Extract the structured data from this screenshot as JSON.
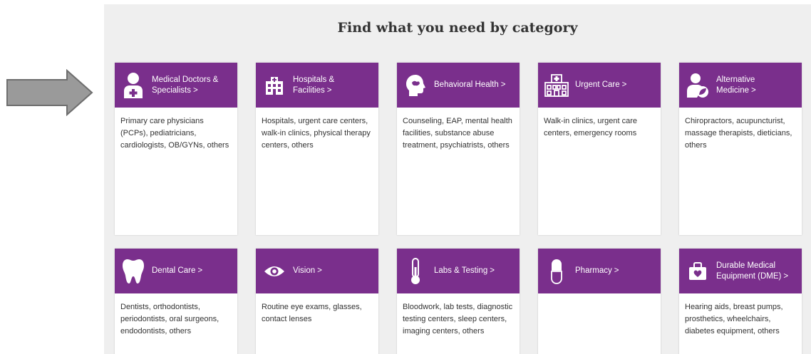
{
  "page": {
    "heading": "Find what you need by category",
    "chevron": ">"
  },
  "categories": [
    {
      "title": "Medical Doctors & Specialists",
      "icon": "doctor-icon",
      "description": "Primary care physicians (PCPs), pediatricians, cardiologists, OB/GYNs, others"
    },
    {
      "title": "Hospitals & Facilities",
      "icon": "hospital-icon",
      "description": "Hospitals, urgent care centers, walk-in clinics, physical therapy centers, others"
    },
    {
      "title": "Behavioral Health",
      "icon": "head-icon",
      "description": "Counseling, EAP, mental health facilities, substance abuse treatment, psychiatrists, others"
    },
    {
      "title": "Urgent Care",
      "icon": "urgent-care-icon",
      "description": "Walk-in clinics, urgent care centers, emergency rooms"
    },
    {
      "title": "Alternative Medicine",
      "icon": "alternative-medicine-icon",
      "description": "Chiropractors, acupuncturist, massage therapists, dieticians, others"
    },
    {
      "title": "Dental Care",
      "icon": "tooth-icon",
      "description": "Dentists, orthodontists, periodontists, oral surgeons, endodontists, others"
    },
    {
      "title": "Vision",
      "icon": "eye-icon",
      "description": "Routine eye exams, glasses, contact lenses"
    },
    {
      "title": "Labs & Testing",
      "icon": "thermometer-icon",
      "description": "Bloodwork, lab tests, diagnostic testing centers, sleep centers, imaging centers, others"
    },
    {
      "title": "Pharmacy",
      "icon": "pill-icon",
      "description": ""
    },
    {
      "title": "Durable Medical Equipment (DME)",
      "icon": "medical-bag-icon",
      "description": "Hearing aids, breast pumps, prosthetics, wheelchairs, diabetes equipment, others"
    }
  ],
  "colors": {
    "accent": "#7a2f8c",
    "panel_background": "#efefef",
    "arrow": "#9a9a9a"
  }
}
